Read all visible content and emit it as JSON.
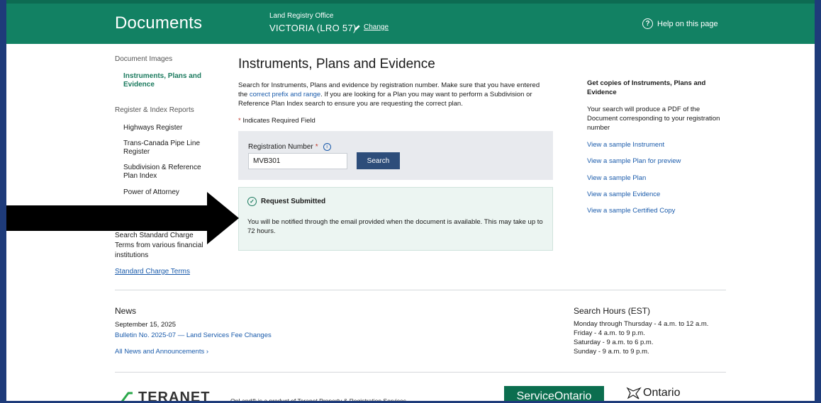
{
  "header": {
    "app_title": "Documents",
    "lro_label": "Land Registry Office",
    "lro_value": "VICTORIA (LRO 57)",
    "change_label": "Change",
    "help_label": "Help on this page",
    "help_icon": "?"
  },
  "sidebar": {
    "heading_images": "Document Images",
    "active_item": "Instruments, Plans and Evidence",
    "heading_reports": "Register & Index Reports",
    "items": [
      {
        "label": "Highways Register"
      },
      {
        "label": "Trans-Canada Pipe Line Register"
      },
      {
        "label": "Subdivision & Reference Plan Index"
      },
      {
        "label": "Power of Attorney"
      }
    ],
    "std_text": "Search Standard Charge Terms from various financial institutions",
    "std_link": "Standard Charge Terms"
  },
  "main": {
    "title": "Instruments, Plans and Evidence",
    "intro_1": "Search for Instruments, Plans and evidence by registration number. Make sure that you have entered the ",
    "intro_link": "correct prefix and range",
    "intro_2": ". If you are looking for a Plan you may want to perform a Subdivision or Reference Plan Index search to ensure you are requesting the correct plan.",
    "required_note": "Indicates Required Field",
    "required_star": "*",
    "reg_label": "Registration Number",
    "reg_value": "MVB301",
    "search_button": "Search",
    "success_title": "Request Submitted",
    "success_message": "You will be notified through the email provided when the document is available. This may take up to 72 hours."
  },
  "right": {
    "heading": "Get copies of Instruments, Plans and Evidence",
    "description": "Your search will produce a PDF of the Document corresponding to your registration number",
    "links": [
      "View a sample Instrument",
      "View a sample Plan for preview",
      "View a sample Plan",
      "View a sample Evidence",
      "View a sample Certified Copy"
    ]
  },
  "news": {
    "title": "News",
    "date": "September 15, 2025",
    "bulletin": "Bulletin No. 2025-07 — Land Services Fee Changes",
    "all_link": "All News and Announcements"
  },
  "hours": {
    "title": "Search Hours (EST)",
    "lines": [
      "Monday through Thursday - 4 a.m. to 12 a.m.",
      "Friday - 4 a.m. to 9 p.m.",
      "Saturday - 9 a.m. to 6 p.m.",
      "Sunday - 9 a.m. to 9 p.m."
    ]
  },
  "footer": {
    "teranet": "TERANET",
    "note": "OnLand® is a product of Teranet Property & Registration Services",
    "service_ontario": "ServiceOntario",
    "ontario": "Ontario"
  },
  "colors": {
    "header_green": "#128163",
    "accent_green": "#1b7a5e",
    "link_blue": "#1a5bab",
    "button_navy": "#2d4d7a",
    "frame_border": "#1e3b7a"
  }
}
